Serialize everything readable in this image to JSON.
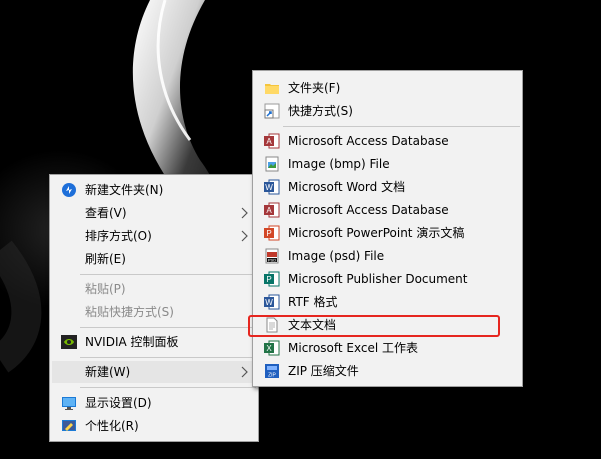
{
  "context_menu": {
    "items": [
      {
        "label": "新建文件夹(N)",
        "icon": "new-folder-icon"
      },
      {
        "label": "查看(V)",
        "has_submenu": true
      },
      {
        "label": "排序方式(O)",
        "has_submenu": true
      },
      {
        "label": "刷新(E)"
      },
      {
        "label": "粘贴(P)",
        "disabled": true
      },
      {
        "label": "粘贴快捷方式(S)",
        "disabled": true
      },
      {
        "label": "NVIDIA 控制面板",
        "icon": "nvidia-icon"
      },
      {
        "label": "新建(W)",
        "has_submenu": true,
        "highlighted": true
      },
      {
        "label": "显示设置(D)",
        "icon": "display-settings-icon"
      },
      {
        "label": "个性化(R)",
        "icon": "personalize-icon"
      }
    ]
  },
  "new_submenu": {
    "items": [
      {
        "label": "文件夹(F)",
        "icon": "folder-icon"
      },
      {
        "label": "快捷方式(S)",
        "icon": "shortcut-icon"
      },
      {
        "label": "Microsoft Access Database",
        "icon": "access-icon"
      },
      {
        "label": "Image (bmp) File",
        "icon": "image-file-icon"
      },
      {
        "label": "Microsoft Word 文档",
        "icon": "word-icon"
      },
      {
        "label": "Microsoft Access Database",
        "icon": "access-icon"
      },
      {
        "label": "Microsoft PowerPoint 演示文稿",
        "icon": "powerpoint-icon"
      },
      {
        "label": "Image (psd) File",
        "icon": "psd-icon"
      },
      {
        "label": "Microsoft Publisher Document",
        "icon": "publisher-icon"
      },
      {
        "label": "RTF 格式",
        "icon": "rtf-icon"
      },
      {
        "label": "文本文档",
        "icon": "text-document-icon",
        "annotated": true
      },
      {
        "label": "Microsoft Excel 工作表",
        "icon": "excel-icon"
      },
      {
        "label": "ZIP 压缩文件",
        "icon": "zip-icon"
      }
    ]
  },
  "colors": {
    "annotation_box": "#e6261f",
    "menu_background": "#f2f2f2",
    "hover_background": "#e5e5e5",
    "disabled_text": "#8a8a8a"
  }
}
